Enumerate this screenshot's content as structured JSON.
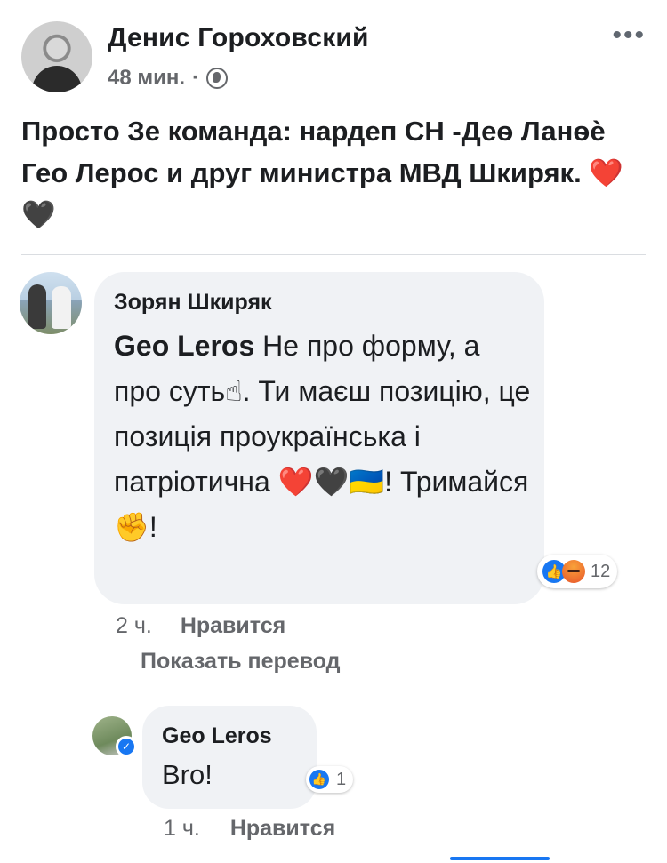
{
  "post": {
    "author": "Денис Гороховский",
    "time": "48 мин.",
    "separator": "·",
    "more": "•••",
    "text": "Просто Зе команда: нардеп СН -Деѳ Ланѳѐ Гео Лерос и друг министра МВД Шкиряк. ❤️🖤"
  },
  "comments": [
    {
      "author": "Зорян Шкиряк",
      "mention": "Geo Leros",
      "text": " Не про форму, а про суть☝. Ти маєш позицію, це позиція проукраїнська і патріотична ❤️🖤🇺🇦! Тримайся✊!",
      "reaction_icons": [
        "like-icon",
        "angry-icon"
      ],
      "reaction_count": "12",
      "time": "2 ч.",
      "like_label": "Нравится",
      "translate_label": "Показать перевод"
    },
    {
      "author": "Geo Leros",
      "text": "Bro!",
      "reaction_icons": [
        "like-icon"
      ],
      "reaction_count": "1",
      "time": "1 ч.",
      "like_label": "Нравится"
    }
  ]
}
